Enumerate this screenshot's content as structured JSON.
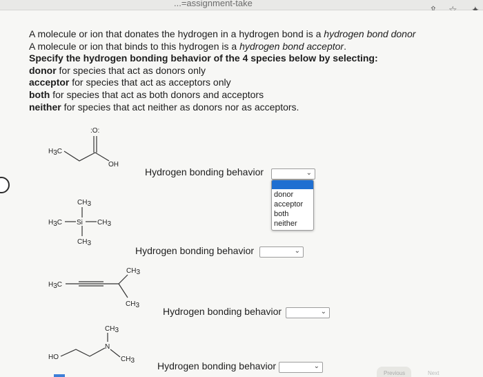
{
  "browser": {
    "url_fragment": "...=assignment-take"
  },
  "question": {
    "line1_a": "A molecule or ion that donates the hydrogen in a hydrogen bond is a ",
    "line1_b": "hydrogen bond donor",
    "line2_a": "A molecule or ion that binds to this hydrogen is a ",
    "line2_b": "hydrogen bond acceptor",
    "line2_c": ".",
    "line3": "Specify the hydrogen bonding behavior of the 4 species below by selecting:",
    "donor_term": "donor",
    "donor_desc": " for species that act as donors only",
    "acceptor_term": "acceptor",
    "acceptor_desc": " for species that act as acceptors only",
    "both_term": "both",
    "both_desc": " for species that act as both donors and acceptors",
    "neither_term": "neither",
    "neither_desc": " for species that act neither as donors nor as acceptors."
  },
  "species": [
    {
      "label": "Hydrogen bonding behavior",
      "selected": ""
    },
    {
      "label": "Hydrogen bonding behavior",
      "selected": ""
    },
    {
      "label": "Hydrogen bonding behavior",
      "selected": ""
    },
    {
      "label": "Hydrogen bonding behavior",
      "selected": ""
    }
  ],
  "dropdown_options": [
    "donor",
    "acceptor",
    "both",
    "neither"
  ],
  "molecule_text": {
    "m1_o": ":O:",
    "m1_h3c": "H",
    "m1_oh": "OH",
    "m2_ch3_top": "CH",
    "m2_h3c": "H",
    "m2_si": "Si",
    "m2_ch3_right": "CH",
    "m2_ch3_bottom": "CH",
    "m3_h3c": "H",
    "m3_ch3_top": "CH",
    "m3_ch3_bottom": "CH",
    "m4_ch3_top": "CH",
    "m4_ho": "HO",
    "m4_n": "N",
    "m4_ch3": "CH",
    "sub3": "3",
    "c": "C"
  },
  "nav": {
    "previous": "Previous",
    "next": "Next"
  },
  "colors": {
    "accent": "#1f6fd1",
    "border": "#9c9c9c"
  }
}
